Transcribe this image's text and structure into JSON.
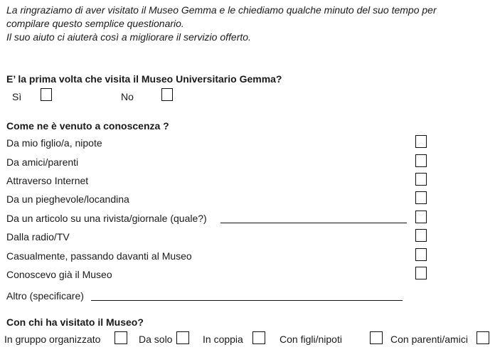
{
  "intro": {
    "line1": "La ringraziamo di aver visitato il Museo Gemma e le chiediamo qualche minuto del suo tempo per",
    "line2": "compilare questo semplice questionario.",
    "line3": "Il suo aiuto ci aiuterà così a migliorare il servizio offerto."
  },
  "q1": {
    "question": "E’ la prima volta che visita il Museo Universitario Gemma?",
    "options": [
      "Sì",
      "No"
    ]
  },
  "q2": {
    "question": "Come ne è venuto a conoscenza ?",
    "options": [
      "Da mio figlio/a, nipote",
      "Da amici/parenti",
      "Attraverso Internet",
      "Da un pieghevole/locandina",
      "Da un articolo su una rivista/giornale (quale?)",
      "Dalla radio/TV",
      "Casualmente, passando davanti al Museo",
      "Conoscevo già il Museo"
    ],
    "other": "Altro (specificare)"
  },
  "q3": {
    "question": "Con chi ha visitato il Museo?",
    "options": [
      "In gruppo organizzato",
      "Da solo",
      "In coppia",
      "Con figli/nipoti",
      "Con parenti/amici"
    ]
  }
}
